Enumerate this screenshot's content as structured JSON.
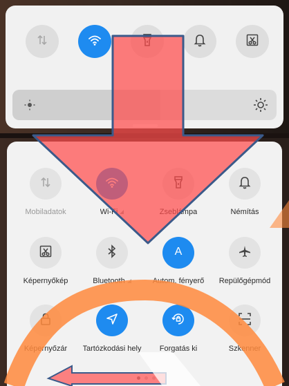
{
  "top_tiles": [
    {
      "icon": "mobile-data-icon",
      "active": false
    },
    {
      "icon": "wifi-icon",
      "active": true
    },
    {
      "icon": "flashlight-icon",
      "active": false
    },
    {
      "icon": "bell-icon",
      "active": false
    },
    {
      "icon": "screenshot-icon",
      "active": false
    }
  ],
  "brightness": {
    "level": 0.56,
    "low_icon": "sun-small-icon",
    "high_icon": "sun-large-icon"
  },
  "tiles": [
    {
      "label": "Mobiladatok",
      "icon": "mobile-data-icon",
      "active": false,
      "dim": true,
      "tri": false
    },
    {
      "label": "Wi-Fi",
      "icon": "wifi-icon",
      "active": true,
      "dim": false,
      "tri": true
    },
    {
      "label": "Zseblámpa",
      "icon": "flashlight-icon",
      "active": false,
      "dim": false,
      "tri": false
    },
    {
      "label": "Némítás",
      "icon": "bell-icon",
      "active": false,
      "dim": false,
      "tri": false
    },
    {
      "label": "Képernyőkép",
      "icon": "screenshot-icon",
      "active": false,
      "dim": false,
      "tri": false
    },
    {
      "label": "Bluetooth",
      "icon": "bluetooth-icon",
      "active": false,
      "dim": false,
      "tri": true
    },
    {
      "label": "Autom. fényerő",
      "icon": "auto-brightness-icon",
      "active": true,
      "dim": false,
      "tri": false
    },
    {
      "label": "Repülőgépmód",
      "icon": "airplane-icon",
      "active": false,
      "dim": false,
      "tri": false
    },
    {
      "label": "Képernyőzár",
      "icon": "lock-icon",
      "active": false,
      "dim": false,
      "tri": false
    },
    {
      "label": "Tartózkodási hely",
      "icon": "location-icon",
      "active": true,
      "dim": false,
      "tri": false
    },
    {
      "label": "Forgatás ki",
      "icon": "rotation-lock-icon",
      "active": true,
      "dim": false,
      "tri": false
    },
    {
      "label": "Szkenner",
      "icon": "scanner-icon",
      "active": false,
      "dim": false,
      "tri": false
    }
  ],
  "page_dots": {
    "count": 3,
    "active": 0
  },
  "colors": {
    "accent": "#1e8bf0",
    "arrow_red": "#ff5a5a",
    "arrow_outline": "#3b5a8a",
    "overlay_orange": "#ff8a3d"
  }
}
